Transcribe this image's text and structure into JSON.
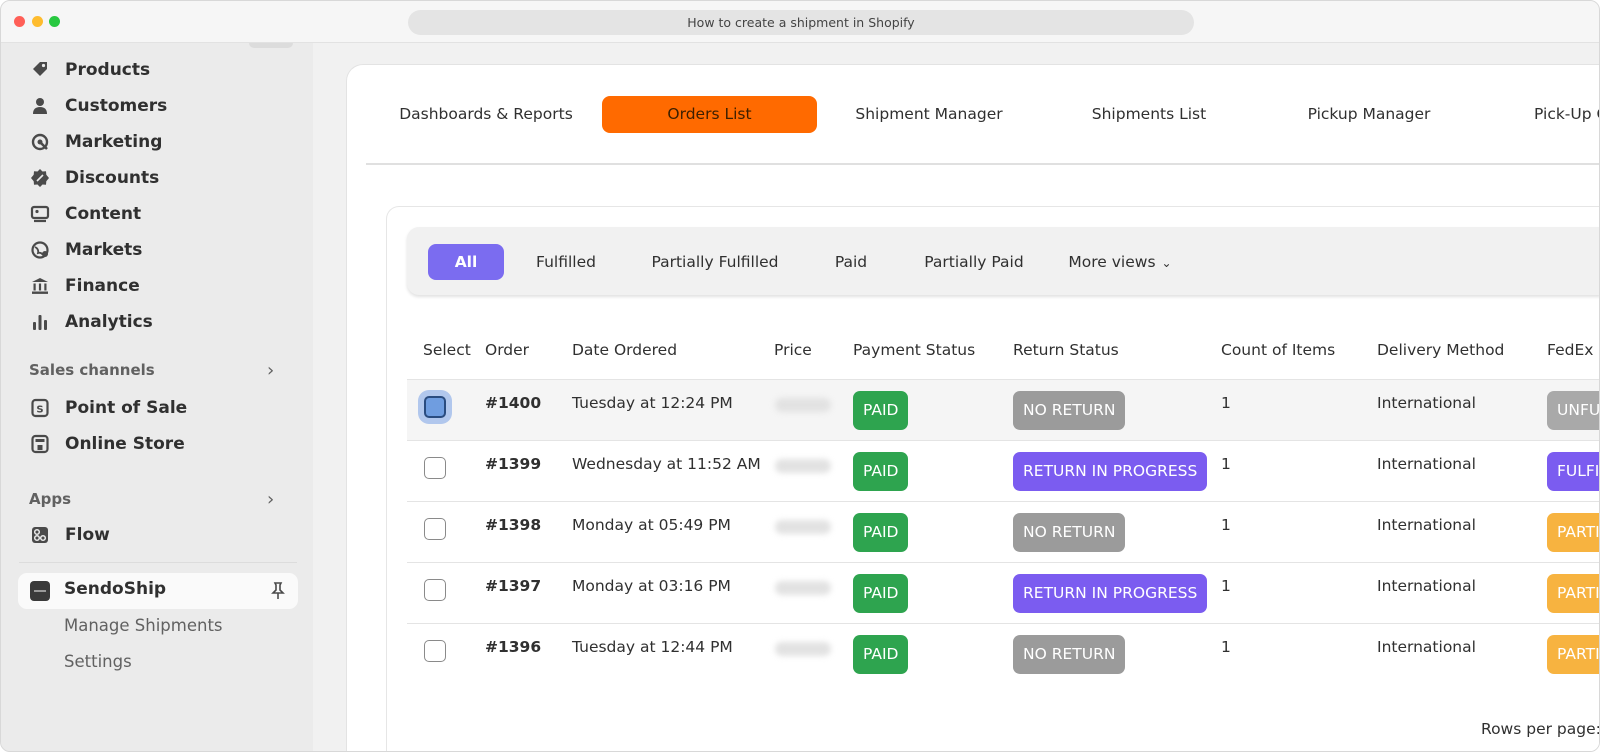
{
  "window": {
    "title": "How to create a shipment in Shopify"
  },
  "sidebar": {
    "items": [
      {
        "label": "Products",
        "icon": "tag-icon"
      },
      {
        "label": "Customers",
        "icon": "person-icon"
      },
      {
        "label": "Marketing",
        "icon": "target-icon"
      },
      {
        "label": "Discounts",
        "icon": "discount-icon"
      },
      {
        "label": "Content",
        "icon": "content-icon"
      },
      {
        "label": "Markets",
        "icon": "globe-icon"
      },
      {
        "label": "Finance",
        "icon": "bank-icon"
      },
      {
        "label": "Analytics",
        "icon": "bar-chart-icon"
      }
    ],
    "sales_channels": {
      "label": "Sales channels",
      "items": [
        {
          "label": "Point of Sale",
          "icon": "pos-icon"
        },
        {
          "label": "Online Store",
          "icon": "store-icon"
        }
      ]
    },
    "apps": {
      "label": "Apps",
      "items": [
        {
          "label": "Flow",
          "icon": "flow-icon"
        }
      ]
    },
    "sendoship": {
      "label": "SendoShip",
      "subitems": [
        "Manage Shipments",
        "Settings"
      ]
    }
  },
  "top_tabs": [
    {
      "label": "Dashboards & Reports"
    },
    {
      "label": "Orders List",
      "active": true
    },
    {
      "label": "Shipment Manager"
    },
    {
      "label": "Shipments List"
    },
    {
      "label": "Pickup Manager"
    },
    {
      "label": "Pick-Up C"
    }
  ],
  "filters": [
    {
      "label": "All",
      "active": true
    },
    {
      "label": "Fulfilled"
    },
    {
      "label": "Partially Fulfilled"
    },
    {
      "label": "Paid"
    },
    {
      "label": "Partially Paid"
    },
    {
      "label": "More views"
    }
  ],
  "table": {
    "headers": [
      "Select",
      "Order",
      "Date Ordered",
      "Price",
      "Payment Status",
      "Return Status",
      "Count of Items",
      "Delivery Method",
      "FedEx S"
    ],
    "rows": [
      {
        "order": "#1400",
        "date": "Tuesday at 12:24 PM",
        "payment": "PAID",
        "return": "NO RETURN",
        "count": "1",
        "delivery": "International",
        "fedex": "UNFU"
      },
      {
        "order": "#1399",
        "date": "Wednesday at 11:52 AM",
        "payment": "PAID",
        "return": "RETURN IN PROGRESS",
        "count": "1",
        "delivery": "International",
        "fedex": "FULFI"
      },
      {
        "order": "#1398",
        "date": "Monday at 05:49 PM",
        "payment": "PAID",
        "return": "NO RETURN",
        "count": "1",
        "delivery": "International",
        "fedex": "PARTI"
      },
      {
        "order": "#1397",
        "date": "Monday at 03:16 PM",
        "payment": "PAID",
        "return": "RETURN IN PROGRESS",
        "count": "1",
        "delivery": "International",
        "fedex": "PARTI"
      },
      {
        "order": "#1396",
        "date": "Tuesday at 12:44 PM",
        "payment": "PAID",
        "return": "NO RETURN",
        "count": "1",
        "delivery": "International",
        "fedex": "PARTI"
      }
    ]
  },
  "footer": {
    "rows_per_page_label": "Rows per page:"
  },
  "colors": {
    "accent_orange": "#ff6a00",
    "accent_purple": "#7b6cf0",
    "paid_green": "#2ea44f",
    "no_return_gray": "#9b9b9b",
    "return_purple": "#7b5cf0",
    "partial_yellow": "#f7b340"
  }
}
